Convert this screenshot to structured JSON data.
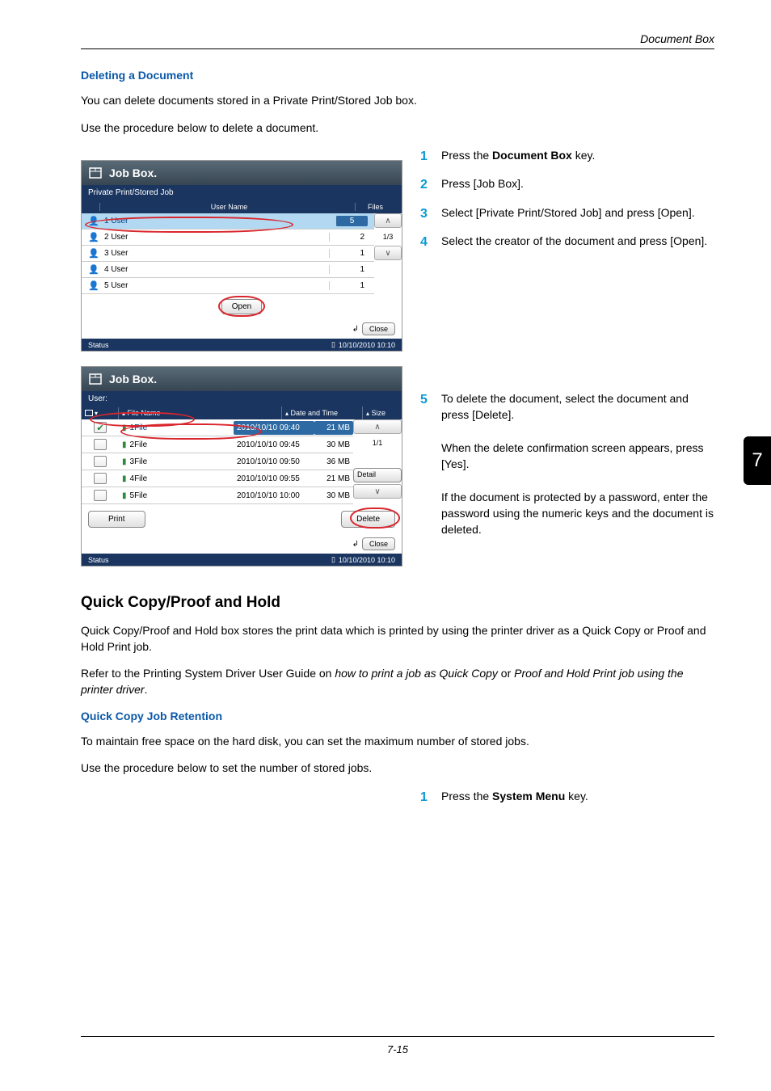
{
  "header": {
    "breadcrumb": "Document Box"
  },
  "intro": {
    "title": "Deleting a Document",
    "p1": "You can delete documents stored in a Private Print/Stored Job box.",
    "p2": "Use the procedure below to delete a document."
  },
  "steps1": {
    "s1": {
      "num": "1",
      "pre": "Press the ",
      "bold": "Document Box",
      "post": " key."
    },
    "s2": {
      "num": "2",
      "text": "Press [Job Box]."
    },
    "s3": {
      "num": "3",
      "text": "Select [Private Print/Stored Job] and press [Open]."
    },
    "s4": {
      "num": "4",
      "text": "Select the creator of the document and press [Open]."
    }
  },
  "steps2": {
    "s5": {
      "num": "5",
      "p1": "To delete the document, select the document and press [Delete].",
      "p2": "When the delete confirmation screen appears, press [Yes].",
      "p3": "If the document is protected by a password, enter the password using the numeric keys and the document is deleted."
    }
  },
  "panel1": {
    "title": "Job Box.",
    "crumb": "Private Print/Stored Job",
    "col_user": "User Name",
    "col_files": "Files",
    "nav_page": "1/3",
    "users": [
      {
        "name": "1 User",
        "files": "5",
        "selected": true
      },
      {
        "name": "2 User",
        "files": "2",
        "selected": false
      },
      {
        "name": "3 User",
        "files": "1",
        "selected": false
      },
      {
        "name": "4 User",
        "files": "1",
        "selected": false
      },
      {
        "name": "5 User",
        "files": "1",
        "selected": false
      }
    ],
    "open": "Open",
    "close": "Close",
    "status": "Status",
    "timestamp": "10/10/2010  10:10"
  },
  "panel2": {
    "title": "Job Box.",
    "crumb": "User:",
    "col_name": "File Name",
    "col_date": "Date and Time",
    "col_size": "Size",
    "nav_page": "1/1",
    "detail": "Detail",
    "files": [
      {
        "name": "1File",
        "date": "2010/10/10 09:40",
        "size": "21 MB",
        "selected": true
      },
      {
        "name": "2File",
        "date": "2010/10/10 09:45",
        "size": "30 MB",
        "selected": false
      },
      {
        "name": "3File",
        "date": "2010/10/10 09:50",
        "size": "36 MB",
        "selected": false
      },
      {
        "name": "4File",
        "date": "2010/10/10 09:55",
        "size": "21 MB",
        "selected": false
      },
      {
        "name": "5File",
        "date": "2010/10/10 10:00",
        "size": "30 MB",
        "selected": false
      }
    ],
    "print": "Print",
    "delete": "Delete",
    "close": "Close",
    "status": "Status",
    "timestamp": "10/10/2010  10:10"
  },
  "section2": {
    "title": "Quick Copy/Proof and Hold",
    "p1": "Quick Copy/Proof and Hold box stores the print data which is printed by using the printer driver as a Quick Copy or Proof and Hold Print job.",
    "p2a": "Refer to the Printing System Driver User Guide on ",
    "p2b": "how to print a job as Quick Copy",
    "p2c": " or ",
    "p2d": "Proof and Hold Print job using the printer driver",
    "p2e": ".",
    "sub": "Quick Copy Job Retention",
    "p3": "To maintain free space on the hard disk, you can set the maximum number of stored jobs.",
    "p4": "Use the procedure below to set the number of stored jobs.",
    "step1": {
      "num": "1",
      "pre": "Press the ",
      "bold": "System Menu",
      "post": " key."
    }
  },
  "tab": "7",
  "footer": "7-15"
}
